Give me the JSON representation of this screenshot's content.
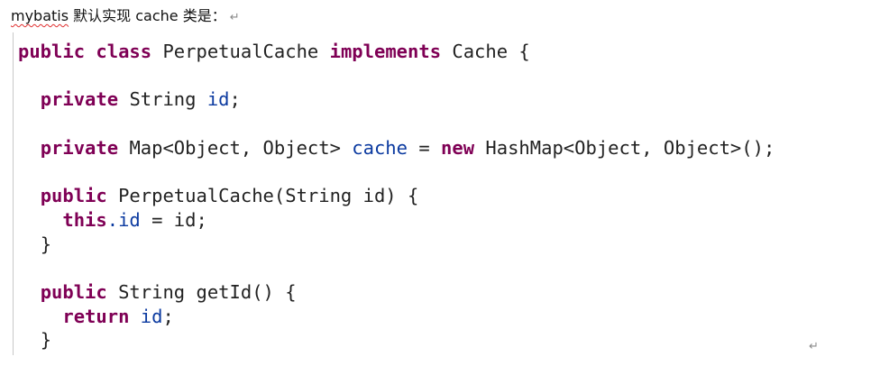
{
  "heading": {
    "word1": "mybatis",
    "rest": " 默认实现 cache 类是：",
    "para_mark": "↵"
  },
  "end_mark": "↵",
  "code": {
    "l1": {
      "kw1": "public",
      "kw2": "class",
      "name": "PerpetualCache",
      "kw3": "implements",
      "iface": "Cache {"
    },
    "l3": {
      "kw": "private",
      "type": "String",
      "field": "id",
      "end": ";"
    },
    "l5": {
      "kw": "private",
      "type": "Map<Object, Object>",
      "field": "cache",
      "eq": "=",
      "kw_new": "new",
      "rest": "HashMap<Object, Object>();"
    },
    "l7": {
      "kw": "public",
      "rest": "PerpetualCache(String id) {"
    },
    "l8": {
      "kw": "this",
      "field": ".id",
      "rest": "= id;"
    },
    "l9": {
      "brace": "}"
    },
    "l11": {
      "kw": "public",
      "rest": "String getId() {"
    },
    "l12": {
      "kw": "return",
      "field": "id",
      "end": ";"
    },
    "l13": {
      "brace": "}"
    }
  }
}
